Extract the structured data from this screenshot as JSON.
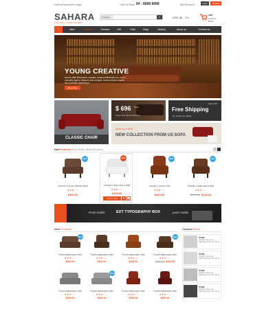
{
  "topbar": {
    "welcome": "Default welcome msg!",
    "call": "Call Us Now",
    "phone": "84 - 8888 8888",
    "account": "My Account",
    "login": "Login",
    "register": "Register"
  },
  "logo": {
    "name": "SAHARA",
    "tagline": "FASHION SOFA STORE"
  },
  "search": {
    "category": "Category",
    "placeholder": ""
  },
  "currency": "USD ($)",
  "language": "En",
  "cart": {
    "label": "cart",
    "items": "0 item(s) - $0.00"
  },
  "nav": [
    "Home",
    "Men",
    "Women",
    "Fashion",
    "Gift",
    "Kids",
    "Blog",
    "Jewelry",
    "About us",
    "Contact us"
  ],
  "hero": {
    "title": "YOUNG CREATIVE",
    "text": "Donec vitae fermentum, sodales, massa sollicitudin non, orci in convallis sapien. Aliquam erat volutpat. Aenean dictum sapien risus porttitor ullamcorper.",
    "button": "Shop Now"
  },
  "banners": {
    "classic": "CLASSIC CHAIR",
    "price": "$ 696",
    "price_only": "Only",
    "price_sub": "Lorem sofa upto for discount",
    "shipping_save": "Save with",
    "shipping": "Free Shipping",
    "shipping_sub": "On Order Over $200",
    "sale_top": "Save up to 50%",
    "sale_main": "NEW COLLECTION FROM US SOFA"
  },
  "tabs": [
    "Hot",
    "Products",
    "Best Seller",
    "Most Reviews"
  ],
  "products": [
    {
      "name": "Lincoln Corner Whole desk",
      "stars": "★★★☆☆",
      "price": "$400.00",
      "old": "",
      "badge": "New",
      "badge_color": "#3aa3dc"
    },
    {
      "name": "Lincoln Chair and a Half",
      "stars": "★★★☆☆",
      "price": "$239.00",
      "old": "",
      "badge": "Sale",
      "badge_color": "#e8501f"
    },
    {
      "name": "Lincoln Corner Unit",
      "stars": "★★★☆☆",
      "price": "$400.00",
      "old": "",
      "badge": "New",
      "badge_color": "#3aa3dc"
    },
    {
      "name": "Lincoln Chair and a Half",
      "stars": "★★★☆☆",
      "price": "$100.00",
      "old": "$190.00",
      "badge": "New",
      "badge_color": "#3aa3dc"
    }
  ],
  "add_to_cart": "Add to Cart",
  "typo": {
    "left": "Proin mattis",
    "main": "EXT TYPOGRAPHY BOX",
    "right": "proin mattis"
  },
  "new_products": {
    "title_a": "New",
    "title_b": "Products"
  },
  "custom_block": {
    "title_a": "Custom",
    "title_b": "Block"
  },
  "grid": [
    {
      "name": "Fuzzie ullamcorper nibh",
      "price": "$400.00",
      "old": "",
      "badge": "New"
    },
    {
      "name": "Fuzzie ullamcorper nibh",
      "price": "$400.00",
      "old": "",
      "badge": ""
    },
    {
      "name": "Fuzzie ullamcorper nibh",
      "price": "$400.00",
      "old": "",
      "badge": ""
    },
    {
      "name": "Fuzzie ullamcorper nibh",
      "price": "$200.00",
      "old": "$300.00",
      "badge": "New"
    },
    {
      "name": "Fuzzie ullamcorper nibh",
      "price": "$400.00",
      "old": "",
      "badge": ""
    },
    {
      "name": "Fuzzie ullamcorper nibh",
      "price": "$400.00",
      "old": "",
      "badge": "New"
    },
    {
      "name": "Fuzzie ullamcorper nibh",
      "price": "$400.00",
      "old": "",
      "badge": ""
    },
    {
      "name": "Fuzzie ullamcorper nibh",
      "price": "$400.00",
      "old": "",
      "badge": ""
    }
  ],
  "grid_stars": "★★★☆☆",
  "custom_items": [
    {
      "title": "Great",
      "text": "Stylish Consumer Sketches Free Fur Sims"
    },
    {
      "title": "Great",
      "text": "Stylish Consumer Sketches Free Fur Sims"
    },
    {
      "title": "Great",
      "text": "Stylish Consumer Sketches Free Fur Sims"
    },
    {
      "title": "Great",
      "text": "Stylish Consumer Sketches Free Fur Sims"
    }
  ],
  "colors": {
    "accent": "#e8501f",
    "dark": "#3a3a3a",
    "blue": "#3aa3dc"
  }
}
